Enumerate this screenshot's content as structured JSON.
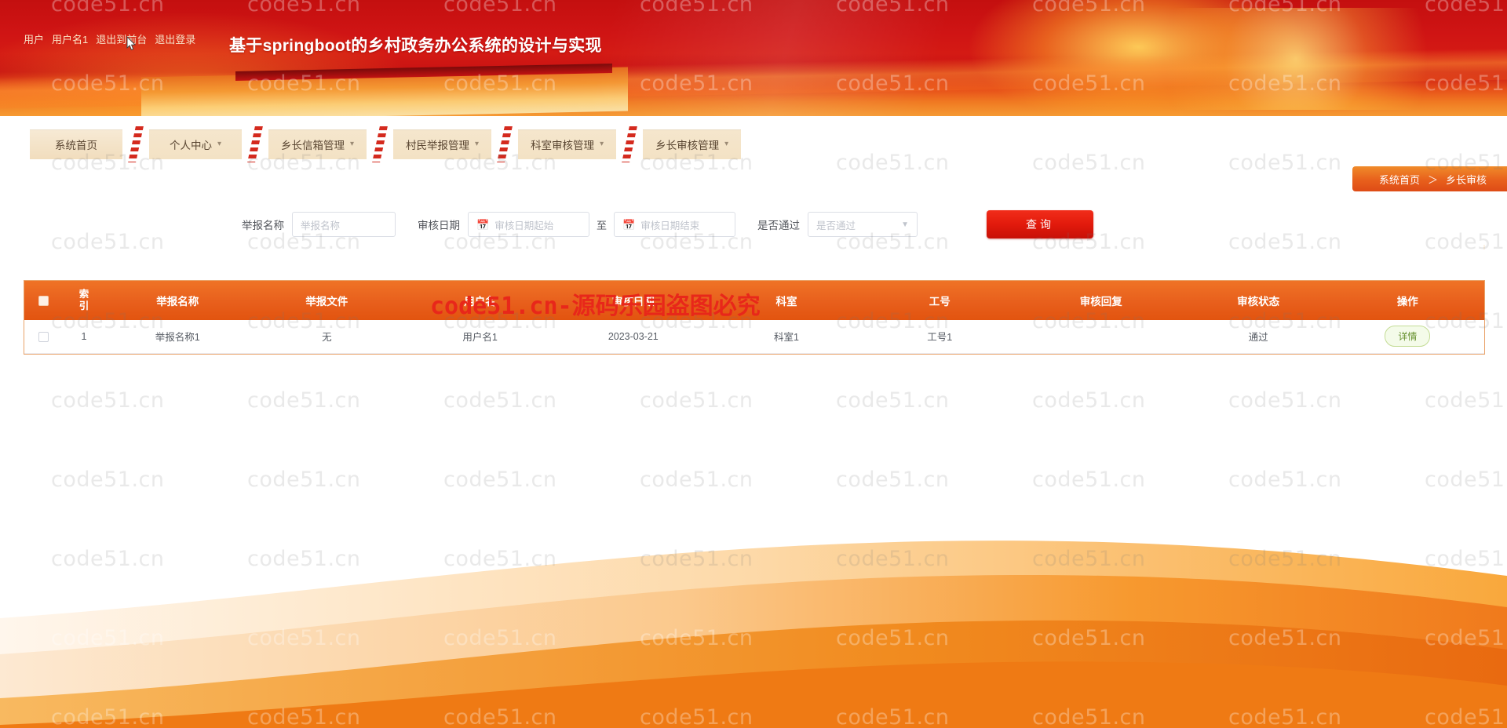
{
  "header": {
    "topbar": {
      "user_label": "用户",
      "username": "用户名1",
      "exit_front": "退出到前台",
      "logout": "退出登录"
    },
    "system_title": "基于springboot的乡村政务办公系统的设计与实现"
  },
  "nav": {
    "items": [
      {
        "label": "系统首页",
        "has_caret": false
      },
      {
        "label": "个人中心",
        "has_caret": true
      },
      {
        "label": "乡长信箱管理",
        "has_caret": true
      },
      {
        "label": "村民举报管理",
        "has_caret": true
      },
      {
        "label": "科室审核管理",
        "has_caret": true
      },
      {
        "label": "乡长审核管理",
        "has_caret": true
      }
    ]
  },
  "breadcrumb": {
    "home": "系统首页",
    "separator": "＞",
    "current": "乡长审核"
  },
  "search": {
    "name_label": "举报名称",
    "name_placeholder": "举报名称",
    "name_value": "",
    "date_label": "审核日期",
    "date_start_placeholder": "审核日期起始",
    "date_start_value": "",
    "between_label": "至",
    "date_end_placeholder": "审核日期结束",
    "date_end_value": "",
    "pass_label": "是否通过",
    "pass_placeholder": "是否通过",
    "pass_value": "",
    "query_button": "查询",
    "calendar_icon": "calendar-icon",
    "caret_icon": "chevron-down-icon"
  },
  "table": {
    "columns": [
      "索引",
      "举报名称",
      "举报文件",
      "用户名",
      "审核日期",
      "科室",
      "工号",
      "审核回复",
      "审核状态",
      "操作"
    ],
    "rows": [
      {
        "index": "1",
        "report_name": "举报名称1",
        "report_file": "无",
        "username": "用户名1",
        "review_date": "2023-03-21",
        "department": "科室1",
        "job_no": "工号1",
        "review_reply": "",
        "review_status": "通过",
        "action": "详情"
      }
    ]
  },
  "watermark": {
    "tile_text": "code51.cn",
    "red_text_ascii": "code51.cn-",
    "red_text_cjk": "源码乐园盗图必究"
  },
  "colors": {
    "banner_red": "#c40f0f",
    "accent_orange": "#e85f1c",
    "query_red": "#e21a0c",
    "nav_tab": "#f3e2c4",
    "detail_green": "#67922f"
  }
}
